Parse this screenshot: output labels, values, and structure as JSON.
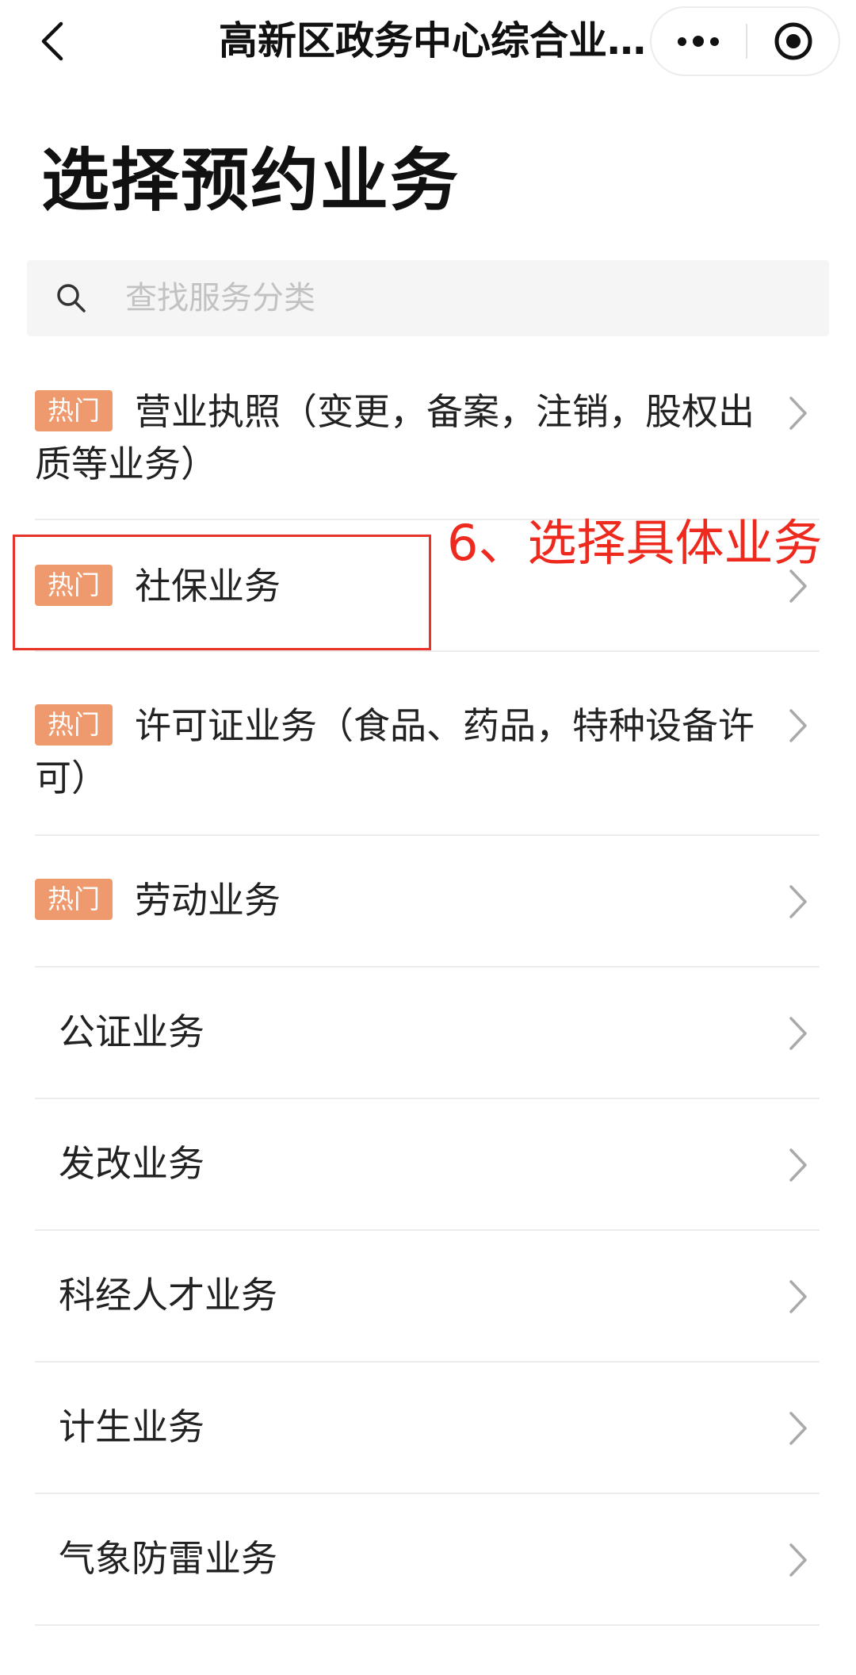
{
  "navbar": {
    "title": "高新区政务中心综合业…"
  },
  "page": {
    "title": "选择预约业务"
  },
  "search": {
    "placeholder": "查找服务分类"
  },
  "items": [
    {
      "hot": true,
      "badge": "热门",
      "label": "营业执照（变更，备案，注销，股权出质等业务）"
    },
    {
      "hot": true,
      "badge": "热门",
      "label": "社保业务"
    },
    {
      "hot": true,
      "badge": "热门",
      "label": "许可证业务（食品、药品，特种设备许可）"
    },
    {
      "hot": true,
      "badge": "热门",
      "label": "劳动业务"
    },
    {
      "hot": false,
      "label": "公证业务"
    },
    {
      "hot": false,
      "label": "发改业务"
    },
    {
      "hot": false,
      "label": "科经人才业务"
    },
    {
      "hot": false,
      "label": "计生业务"
    },
    {
      "hot": false,
      "label": "气象防雷业务"
    }
  ],
  "annotation": {
    "text": "6、选择具体业务",
    "color": "#ee2a1f"
  },
  "colors": {
    "badge": "#ef9a6e",
    "divider": "#ececec",
    "search_bg": "#f5f5f5"
  }
}
